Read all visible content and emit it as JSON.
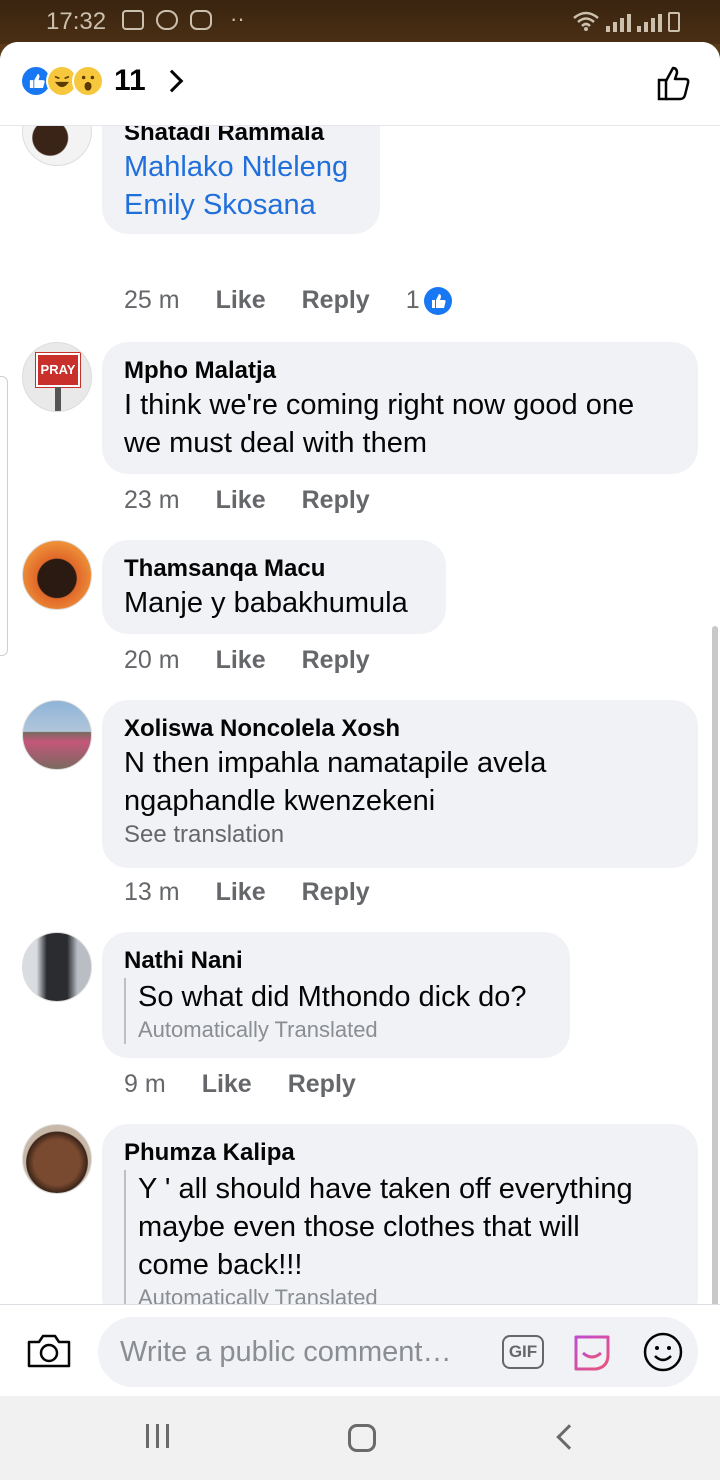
{
  "status_bar": {
    "time": "17:32"
  },
  "header": {
    "reaction_count": "11"
  },
  "comments": [
    {
      "name": "Shatadi Rammala",
      "lines": [
        "Mahlako Ntleleng",
        "Emily Skosana"
      ],
      "time": "25 m",
      "like": "Like",
      "reply": "Reply",
      "reaction_count": "1"
    },
    {
      "name": "Mpho Malatja",
      "lines": [
        "I think we're coming right now good one",
        "we must deal with them"
      ],
      "time": "23 m",
      "like": "Like",
      "reply": "Reply",
      "avatar_text": "PRAY"
    },
    {
      "name": "Thamsanqa Macu",
      "lines": [
        "Manje y babakhumula"
      ],
      "time": "20 m",
      "like": "Like",
      "reply": "Reply"
    },
    {
      "name": "Xoliswa Noncolela Xosh",
      "lines": [
        "N then impahla namatapile avela",
        "ngaphandle kwenzekeni"
      ],
      "see_translation": "See translation",
      "time": "13 m",
      "like": "Like",
      "reply": "Reply"
    },
    {
      "name": "Nathi Nani",
      "lines": [
        "So what did Mthondo dick do?"
      ],
      "auto_translated": "Automatically Translated",
      "time": "9 m",
      "like": "Like",
      "reply": "Reply"
    },
    {
      "name": "Phumza Kalipa",
      "lines": [
        "Y ' all should have taken off everything",
        "maybe even those clothes that will",
        "come back!!!"
      ],
      "auto_translated": "Automatically Translated"
    }
  ],
  "composer": {
    "placeholder": "Write a public comment…",
    "gif_label": "GIF"
  },
  "colors": {
    "facebook_blue": "#1877f2",
    "bubble_bg": "#f0f2f5",
    "meta_gray": "#65676b",
    "tag_blue": "#216fdb"
  }
}
